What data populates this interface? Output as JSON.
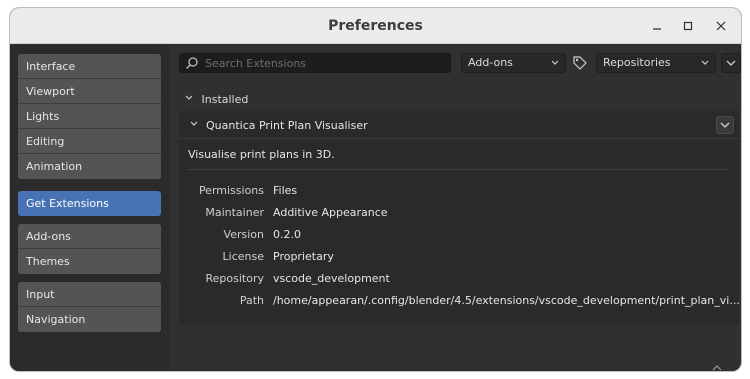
{
  "window": {
    "title": "Preferences",
    "controls": {
      "minimize": "–",
      "maximize": "□",
      "close": "✕"
    }
  },
  "sidebar": {
    "groups": [
      [
        {
          "label": "Interface",
          "name": "sidebar-item-interface"
        },
        {
          "label": "Viewport",
          "name": "sidebar-item-viewport"
        },
        {
          "label": "Lights",
          "name": "sidebar-item-lights"
        },
        {
          "label": "Editing",
          "name": "sidebar-item-editing"
        },
        {
          "label": "Animation",
          "name": "sidebar-item-animation"
        }
      ],
      [
        {
          "label": "Get Extensions",
          "name": "sidebar-item-get-extensions",
          "active": true
        }
      ],
      [
        {
          "label": "Add-ons",
          "name": "sidebar-item-add-ons"
        },
        {
          "label": "Themes",
          "name": "sidebar-item-themes"
        }
      ],
      [
        {
          "label": "Input",
          "name": "sidebar-item-input"
        },
        {
          "label": "Navigation",
          "name": "sidebar-item-navigation"
        }
      ]
    ]
  },
  "toolbar": {
    "search_placeholder": "Search Extensions",
    "type_filter": "Add-ons",
    "repo_filter": "Repositories"
  },
  "installed": {
    "label": "Installed"
  },
  "extension": {
    "name": "Quantica Print Plan Visualiser",
    "description": "Visualise print plans in 3D.",
    "properties": [
      {
        "label": "Permissions",
        "value": "Files"
      },
      {
        "label": "Maintainer",
        "value": "Additive Appearance"
      },
      {
        "label": "Version",
        "value": "0.2.0"
      },
      {
        "label": "License",
        "value": "Proprietary"
      },
      {
        "label": "Repository",
        "value": "vscode_development"
      },
      {
        "label": "Path",
        "value": "/home/appearan/.config/blender/4.5/extensions/vscode_development/print_plan_vi..."
      }
    ]
  },
  "colors": {
    "accent": "#4772b3",
    "background": "#303030",
    "sidebar_item": "#545454",
    "titlebar": "#ebebeb"
  }
}
